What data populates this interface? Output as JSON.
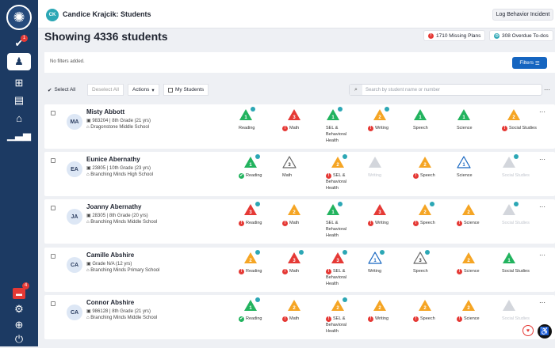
{
  "header": {
    "initials": "CK",
    "title": "Candice Krajcik: Students",
    "log_button": "Log Behavior Incident"
  },
  "page": {
    "title": "Showing 4336 students",
    "missing_plans": "1710 Missing Plans",
    "overdue": "308 Overdue To-dos"
  },
  "filters": {
    "text": "No filters added.",
    "button": "Filters"
  },
  "toolbar": {
    "select_all": "Select All",
    "deselect_all": "Deselect All",
    "actions": "Actions",
    "my_students": "My Students",
    "search_placeholder": "Search by student name or number"
  },
  "nav_badges": {
    "tasks": "1",
    "chat": "4"
  },
  "colors": {
    "red": "#e53935",
    "orange": "#f5a524",
    "green": "#22b35e",
    "blue": "#1565c0",
    "grey": "#d3d6dc",
    "teal": "#2ca7b5"
  },
  "students": [
    {
      "initials": "MA",
      "name": "Misty Abbott",
      "id": "983204 | 8th Grade (21 yrs)",
      "school": "Dragonstone Middle School",
      "subjects": [
        {
          "label": "Reading",
          "color": "green",
          "num": "1",
          "notif": true,
          "alert": ""
        },
        {
          "label": "Math",
          "color": "red",
          "num": "3",
          "notif": false,
          "alert": "red"
        },
        {
          "label": "SEL & Behavioral Health",
          "color": "green",
          "num": "1",
          "notif": true,
          "alert": ""
        },
        {
          "label": "Writing",
          "color": "orange",
          "num": "2",
          "notif": true,
          "alert": "red"
        },
        {
          "label": "Speech",
          "color": "green",
          "num": "1",
          "notif": false,
          "alert": ""
        },
        {
          "label": "Science",
          "color": "green",
          "num": "1",
          "notif": false,
          "alert": ""
        },
        {
          "label": "Social Studies",
          "color": "orange",
          "num": "2",
          "notif": false,
          "alert": "red"
        }
      ]
    },
    {
      "initials": "EA",
      "name": "Eunice Abernathy",
      "id": "23805 | 10th Grade (23 yrs)",
      "school": "Branching Minds High School",
      "subjects": [
        {
          "label": "Reading",
          "color": "green",
          "num": "1",
          "notif": true,
          "alert": "green"
        },
        {
          "label": "Math",
          "color": "outline-grey",
          "num": "3",
          "notif": false,
          "alert": ""
        },
        {
          "label": "SEL & Behavioral Health",
          "color": "orange",
          "num": "2",
          "notif": true,
          "alert": "red"
        },
        {
          "label": "Writing",
          "color": "grey",
          "num": "",
          "notif": false,
          "alert": ""
        },
        {
          "label": "Speech",
          "color": "orange",
          "num": "2",
          "notif": false,
          "alert": "red"
        },
        {
          "label": "Science",
          "color": "outline-blue",
          "num": "1",
          "notif": false,
          "alert": ""
        },
        {
          "label": "Social Studies",
          "color": "grey",
          "num": "",
          "notif": true,
          "alert": ""
        }
      ]
    },
    {
      "initials": "JA",
      "name": "Joanny Abernathy",
      "id": "28305 | 8th Grade (20 yrs)",
      "school": "Branching Minds Middle School",
      "subjects": [
        {
          "label": "Reading",
          "color": "red",
          "num": "3",
          "notif": true,
          "alert": "red"
        },
        {
          "label": "Math",
          "color": "orange",
          "num": "2",
          "notif": false,
          "alert": "red"
        },
        {
          "label": "SEL & Behavioral Health",
          "color": "green",
          "num": "1",
          "notif": true,
          "alert": ""
        },
        {
          "label": "Writing",
          "color": "red",
          "num": "3",
          "notif": false,
          "alert": "red"
        },
        {
          "label": "Speech",
          "color": "orange",
          "num": "2",
          "notif": true,
          "alert": "red"
        },
        {
          "label": "Science",
          "color": "orange",
          "num": "2",
          "notif": false,
          "alert": "red"
        },
        {
          "label": "Social Studies",
          "color": "grey",
          "num": "",
          "notif": true,
          "alert": ""
        }
      ]
    },
    {
      "initials": "CA",
      "name": "Camille Abshire",
      "id": "Grade N/A (12 yrs)",
      "school": "Branching Minds Primary School",
      "subjects": [
        {
          "label": "Reading",
          "color": "orange",
          "num": "2",
          "notif": true,
          "alert": "red"
        },
        {
          "label": "Math",
          "color": "red",
          "num": "3",
          "notif": true,
          "alert": "red"
        },
        {
          "label": "SEL & Behavioral Health",
          "color": "red",
          "num": "3",
          "notif": true,
          "alert": "red"
        },
        {
          "label": "Writing",
          "color": "outline-blue",
          "num": "1",
          "notif": true,
          "alert": ""
        },
        {
          "label": "Speech",
          "color": "outline-grey",
          "num": "3",
          "notif": true,
          "alert": ""
        },
        {
          "label": "Science",
          "color": "orange",
          "num": "2",
          "notif": false,
          "alert": "red"
        },
        {
          "label": "Social Studies",
          "color": "green",
          "num": "1",
          "notif": false,
          "alert": ""
        }
      ]
    },
    {
      "initials": "CA",
      "name": "Connor Abshire",
      "id": "986128 | 8th Grade (21 yrs)",
      "school": "Branching Minds Middle School",
      "subjects": [
        {
          "label": "Reading",
          "color": "green",
          "num": "1",
          "notif": true,
          "alert": "green"
        },
        {
          "label": "Math",
          "color": "orange",
          "num": "2",
          "notif": false,
          "alert": "red"
        },
        {
          "label": "SEL & Behavioral Health",
          "color": "orange",
          "num": "2",
          "notif": true,
          "alert": "red"
        },
        {
          "label": "Writing",
          "color": "orange",
          "num": "2",
          "notif": false,
          "alert": "red"
        },
        {
          "label": "Speech",
          "color": "orange",
          "num": "2",
          "notif": false,
          "alert": "red"
        },
        {
          "label": "Science",
          "color": "orange",
          "num": "2",
          "notif": false,
          "alert": "red"
        },
        {
          "label": "Social Studies",
          "color": "grey",
          "num": "",
          "notif": false,
          "alert": ""
        }
      ]
    }
  ]
}
